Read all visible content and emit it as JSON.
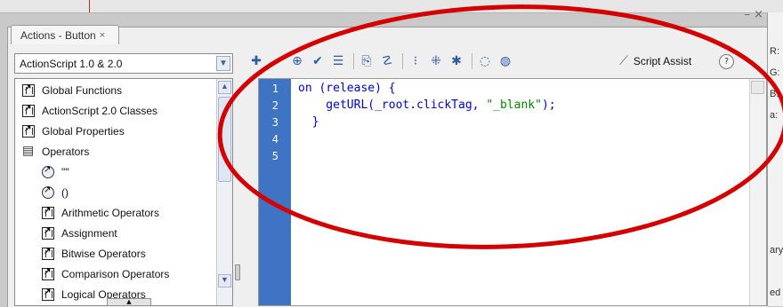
{
  "window": {
    "tab_label": "Actions - Button",
    "tab_close": "×",
    "min_glyph": "– ×",
    "menu_glyph": "▾☰"
  },
  "left": {
    "dropdown_value": "ActionScript 1.0 & 2.0",
    "tree": [
      {
        "label": "Global Functions",
        "icon": "book-icon"
      },
      {
        "label": "ActionScript 2.0 Classes",
        "icon": "book-icon"
      },
      {
        "label": "Global Properties",
        "icon": "book-icon"
      },
      {
        "label": "Operators",
        "icon": "open-book-icon"
      },
      {
        "label": "\"\"",
        "icon": "operator-icon"
      },
      {
        "label": "()",
        "icon": "operator-icon"
      },
      {
        "label": "Arithmetic Operators",
        "icon": "book-icon"
      },
      {
        "label": "Assignment",
        "icon": "book-icon"
      },
      {
        "label": "Bitwise Operators",
        "icon": "book-icon"
      },
      {
        "label": "Comparison Operators",
        "icon": "book-icon"
      },
      {
        "label": "Logical Operators",
        "icon": "book-icon"
      }
    ]
  },
  "toolbar": {
    "script_assist": "Script Assist",
    "help": "?"
  },
  "editor": {
    "line_numbers": [
      "1",
      "2",
      "3",
      "4",
      "5"
    ],
    "lines": [
      {
        "code": "on (release) {",
        "str": ""
      },
      {
        "code": "    getURL(_root.clickTag, ",
        "str": "\"_blank\"",
        "tail": ");"
      },
      {
        "code": "  }",
        "str": ""
      }
    ]
  },
  "right_strip": {
    "labels": [
      "R:",
      "G:",
      "B:",
      "a:",
      "ary",
      "ed"
    ]
  },
  "colors": {
    "gutter": "#3f73c4",
    "annotation": "#d40000",
    "code_keyword": "#0000cc",
    "code_string": "#008800"
  }
}
